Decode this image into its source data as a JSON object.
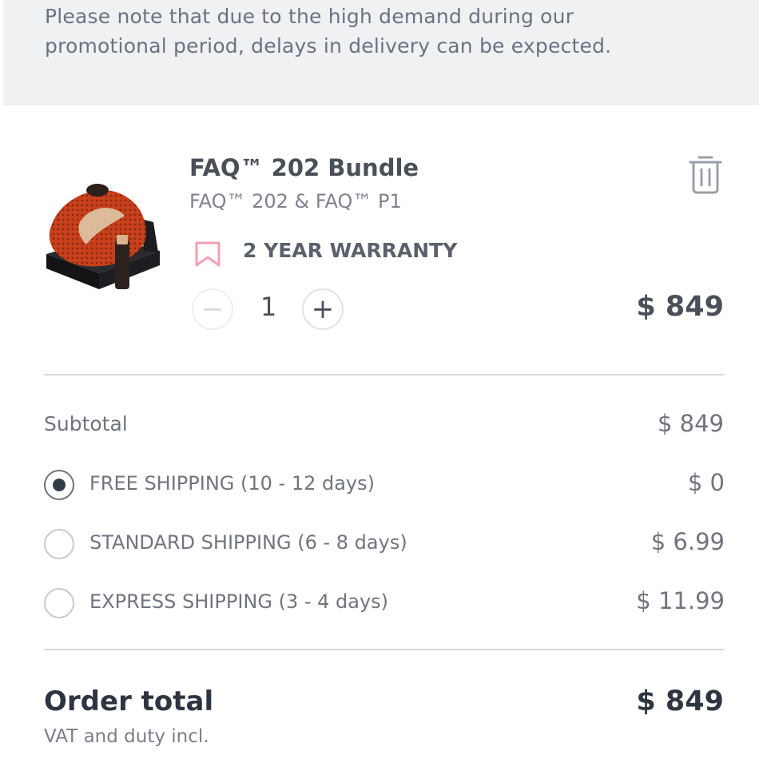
{
  "notice": {
    "line1": "Please note that due to the high demand during our",
    "line2": "promotional period, delays in delivery can be expected."
  },
  "cart_item": {
    "title": "FAQ™ 202 Bundle",
    "subtitle": "FAQ™ 202 & FAQ™ P1",
    "warranty": "2 YEAR WARRANTY",
    "quantity": "1",
    "price": "$ 849",
    "image_icon": "product-image",
    "remove_icon": "trash-icon",
    "warranty_icon": "bookmark-icon",
    "colors": {
      "warranty_icon": "#f4a0b0",
      "product_body": "#c8401c"
    }
  },
  "summary": {
    "subtotal_label": "Subtotal",
    "subtotal_value": "$ 849",
    "shipping_options": [
      {
        "label": "FREE SHIPPING (10 - 12 days)",
        "price": "$ 0",
        "selected": true
      },
      {
        "label": "STANDARD SHIPPING (6 - 8 days)",
        "price": "$ 6.99",
        "selected": false
      },
      {
        "label": "EXPRESS SHIPPING (3 - 4 days)",
        "price": "$ 11.99",
        "selected": false
      }
    ],
    "total_label": "Order total",
    "total_value": "$ 849",
    "vat_note": "VAT and duty incl."
  }
}
